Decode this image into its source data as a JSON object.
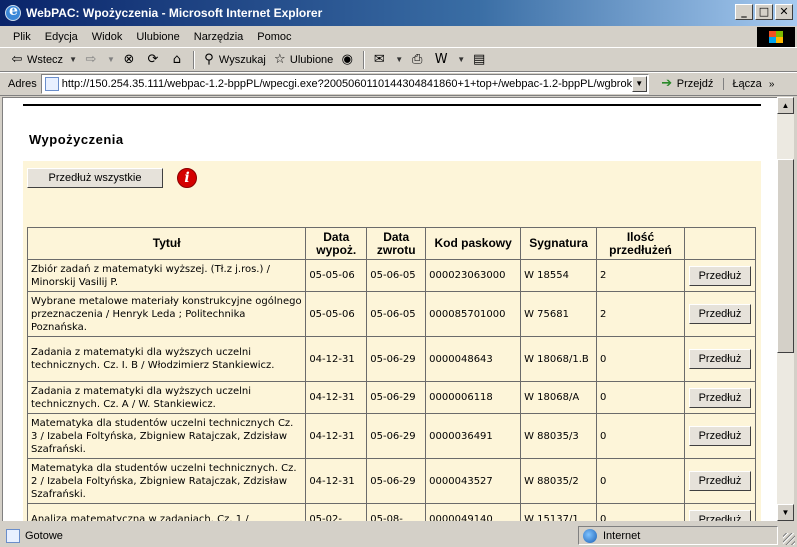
{
  "window": {
    "title": "WebPAC: Wpożyczenia - Microsoft Internet Explorer",
    "buttons": [
      "_",
      "□",
      "✕"
    ]
  },
  "menu": [
    "Plik",
    "Edycja",
    "Widok",
    "Ulubione",
    "Narzędzia",
    "Pomoc"
  ],
  "toolbar": {
    "back": "Wstecz",
    "search": "Wyszukaj",
    "favorites": "Ulubione"
  },
  "address": {
    "label": "Adres",
    "url": "http://150.254.35.111/webpac-1.2-bppPL/wpecgi.exe?2005060110144304841860+1+top+/webpac-1.2-bppPL/wgbroker",
    "go": "Przejdź",
    "links": "Łącza"
  },
  "page": {
    "title": "Wypożyczenia",
    "renew_all": "Przedłuż wszystkie",
    "info_icon": "i"
  },
  "table": {
    "headers": {
      "title": "Tytuł",
      "loan_date": "Data wypoż.",
      "return_date": "Data zwrotu",
      "barcode": "Kod paskowy",
      "signature": "Sygnatura",
      "renewals": "Ilość przedłużeń"
    },
    "renew_label": "Przedłuż",
    "rows": [
      {
        "title": "Zbiór zadań z matematyki wyższej. (Tł.z j.ros.) / Minorskij Vasilij P.",
        "loan": "05-05-06",
        "due": "05-06-05",
        "barcode": "000023063000",
        "signature": "W 18554",
        "renewals": "2"
      },
      {
        "title": "Wybrane metalowe materiały konstrukcyjne ogólnego przeznaczenia / Henryk Leda ; Politechnika Poznańska.",
        "loan": "05-05-06",
        "due": "05-06-05",
        "barcode": "000085701000",
        "signature": "W 75681",
        "renewals": "2"
      },
      {
        "title": "Zadania z matematyki dla wyższych uczelni technicznych. Cz. I. B / Włodzimierz Stankiewicz.",
        "loan": "04-12-31",
        "due": "05-06-29",
        "barcode": "0000048643",
        "signature": "W 18068/1.B",
        "renewals": "0"
      },
      {
        "title": "Zadania z matematyki dla wyższych uczelni technicznych. Cz. A / W. Stankiewicz.",
        "loan": "04-12-31",
        "due": "05-06-29",
        "barcode": "0000006118",
        "signature": "W 18068/A",
        "renewals": "0"
      },
      {
        "title": "Matematyka dla studentów uczelni technicznych Cz. 3 / Izabela Foltyńska, Zbigniew Ratajczak, Zdzisław Szafrański.",
        "loan": "04-12-31",
        "due": "05-06-29",
        "barcode": "0000036491",
        "signature": "W 88035/3",
        "renewals": "0"
      },
      {
        "title": "Matematyka dla studentów uczelni technicznych. Cz. 2 / Izabela Foltyńska, Zbigniew Ratajczak, Zdzisław Szafrański.",
        "loan": "04-12-31",
        "due": "05-06-29",
        "barcode": "0000043527",
        "signature": "W 88035/2",
        "renewals": "0"
      },
      {
        "title": "Analiza matematyczna w zadaniach. Cz. 1 /",
        "loan": "05-02-",
        "due": "05-08-",
        "barcode": "0000049140",
        "signature": "W 15137/1",
        "renewals": "0"
      }
    ]
  },
  "status": {
    "text": "Gotowe",
    "zone": "Internet"
  }
}
